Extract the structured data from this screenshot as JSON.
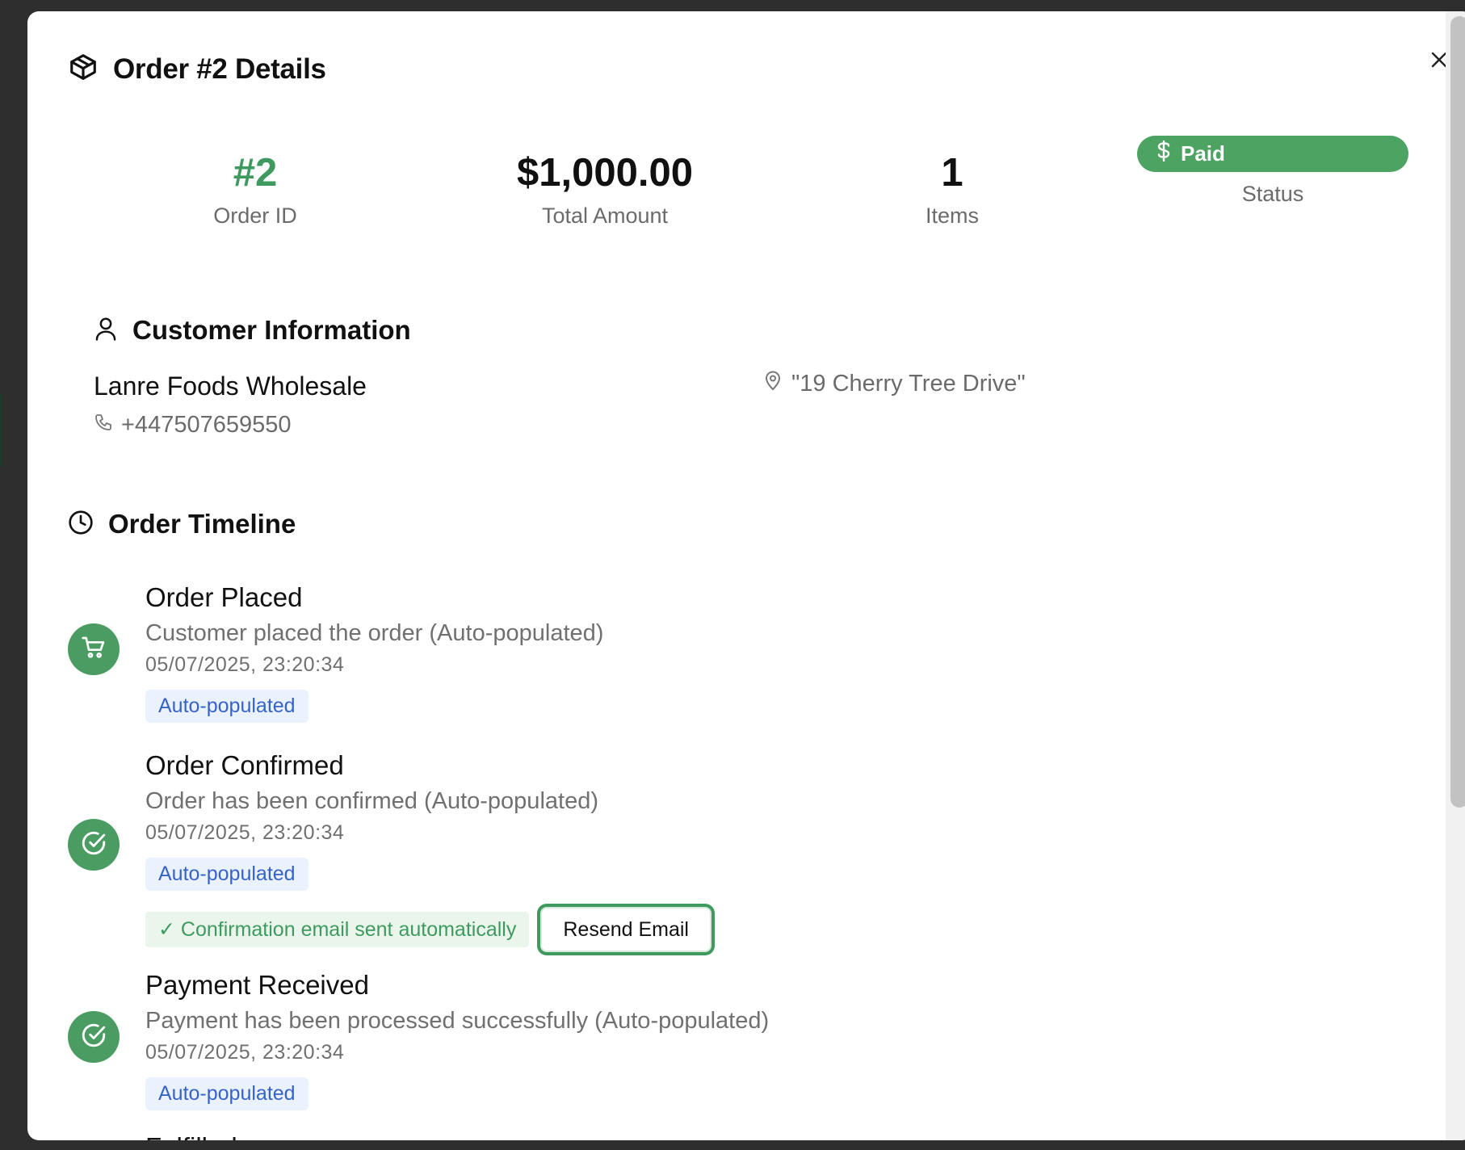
{
  "modal": {
    "title": "Order #2 Details",
    "close_label": "×"
  },
  "stats": {
    "order_id": {
      "value": "#2",
      "label": "Order ID"
    },
    "total": {
      "value": "$1,000.00",
      "label": "Total Amount"
    },
    "items": {
      "value": "1",
      "label": "Items"
    },
    "status": {
      "value": "Paid",
      "label": "Status"
    }
  },
  "customer": {
    "section_title": "Customer Information",
    "name": "Lanre Foods Wholesale",
    "phone": "+447507659550",
    "address": "\"19 Cherry Tree Drive\""
  },
  "timeline": {
    "section_title": "Order Timeline",
    "events": [
      {
        "title": "Order Placed",
        "description": "Customer placed the order (Auto-populated)",
        "time": "05/07/2025, 23:20:34",
        "tag": "Auto-populated",
        "icon": "cart-icon"
      },
      {
        "title": "Order Confirmed",
        "description": "Order has been confirmed (Auto-populated)",
        "time": "05/07/2025, 23:20:34",
        "tag": "Auto-populated",
        "icon": "check-circle-icon",
        "confirmation_note": "✓ Confirmation email sent automatically",
        "resend_label": "Resend Email"
      },
      {
        "title": "Payment Received",
        "description": "Payment has been processed successfully (Auto-populated)",
        "time": "05/07/2025, 23:20:34",
        "tag": "Auto-populated",
        "icon": "check-circle-icon"
      },
      {
        "title": "Fulfilled"
      }
    ]
  },
  "colors": {
    "accent_green": "#4da462",
    "tag_blue": "#3763c9",
    "tag_bg": "#eaf2fd"
  }
}
